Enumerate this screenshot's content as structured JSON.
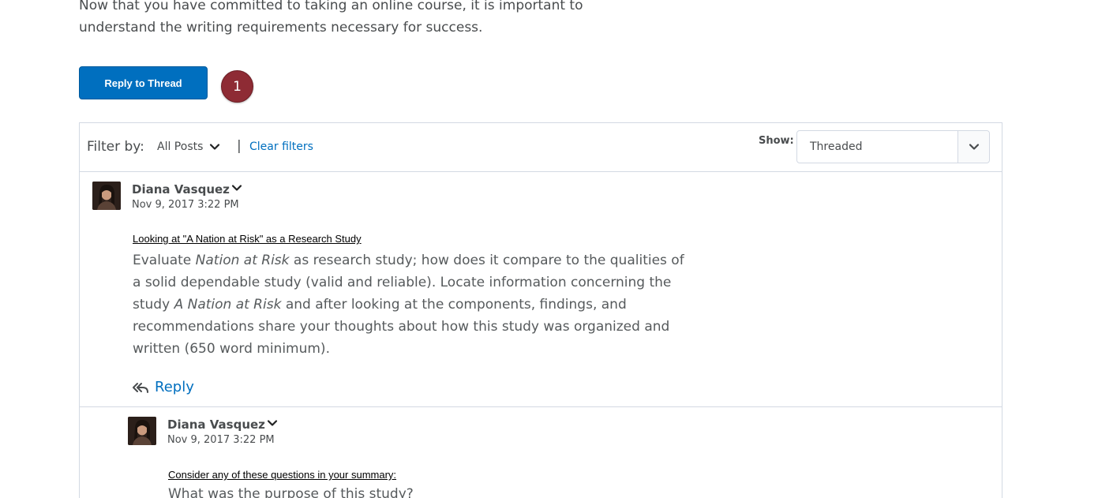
{
  "intro": {
    "line1": "Now that you have committed to taking an online course, it is important to",
    "line2": "understand the writing requirements necessary for success."
  },
  "reply_to_thread_label": "Reply to Thread",
  "step_badge": "1",
  "filter": {
    "label": "Filter by:",
    "selected": "All Posts",
    "separator": "|",
    "clear": "Clear filters"
  },
  "show": {
    "label": "Show:",
    "selected": "Threaded"
  },
  "posts": [
    {
      "author": "Diana Vasquez",
      "date": "Nov 9, 2017 3:22 PM",
      "subject": "Looking at \"A Nation at Risk\" as a Research Study",
      "body": {
        "p1": "Evaluate ",
        "p1_italic": "Nation at Risk",
        "p1_rest": " as research study; how does it compare to the qualities of",
        "line2": "a solid dependable study (valid and reliable). Locate information concerning the",
        "line3_a": "study ",
        "line3_italic": "A Nation at Risk",
        "line3_b": " and after looking at the components, findings, and",
        "line4": "recommendations share your thoughts about how this study was organized and",
        "line5": "written (650 word minimum)."
      },
      "reply_label": "Reply"
    },
    {
      "author": "Diana Vasquez",
      "date": "Nov 9, 2017 3:22 PM",
      "subject": "Consider any of these questions in your summary:",
      "body_line1": "What was the purpose of this study?"
    }
  ],
  "colors": {
    "primary": "#006fbf",
    "badge": "#8e2b34",
    "border": "#d3d9e3",
    "text": "#494c4e"
  }
}
